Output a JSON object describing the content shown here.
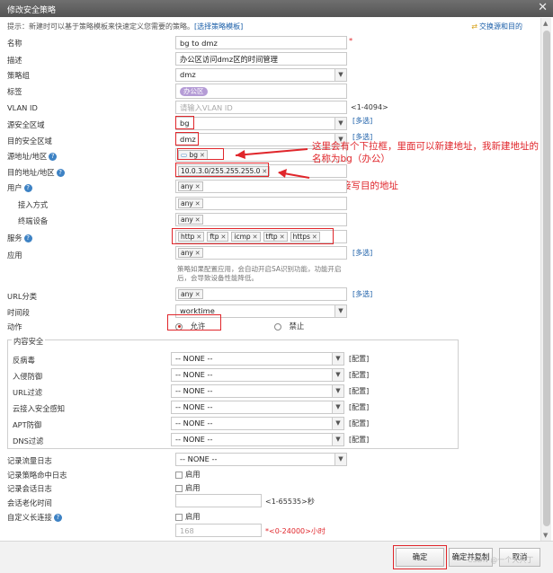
{
  "dialog": {
    "title": "修改安全策略",
    "close": "✕"
  },
  "hint": {
    "text": "提示：新建时可以基于策略模板来快速定义您需要的策略。",
    "link": "[选择策略模板]"
  },
  "swap": {
    "icon": "swap-icon",
    "label": "交换源和目的"
  },
  "fields": {
    "name": {
      "label": "名称",
      "value": "bg to dmz",
      "required": "*"
    },
    "desc": {
      "label": "描述",
      "value": "办公区访问dmz区的时间管理"
    },
    "group": {
      "label": "策略组",
      "value": "dmz"
    },
    "tag": {
      "label": "标签",
      "value": "办公区"
    },
    "vlan": {
      "label": "VLAN ID",
      "placeholder": "请输入VLAN ID",
      "range": "<1-4094>"
    },
    "src_zone": {
      "label": "源安全区域",
      "value": "bg",
      "multi": "[多选]"
    },
    "dst_zone": {
      "label": "目的安全区域",
      "value": "dmz",
      "multi": "[多选]"
    },
    "src_addr": {
      "label": "源地址/地区",
      "value": "bg"
    },
    "dst_addr": {
      "label": "目的地址/地区",
      "value": "10.0.3.0/255.255.255.0"
    },
    "user": {
      "label": "用户",
      "value": "any"
    },
    "access": {
      "label": "接入方式",
      "value": "any"
    },
    "terminal": {
      "label": "终端设备",
      "value": "any"
    },
    "service": {
      "label": "服务",
      "tags": [
        "http",
        "ftp",
        "icmp",
        "tftp",
        "https"
      ]
    },
    "app": {
      "label": "应用",
      "value": "any",
      "multi": "[多选]",
      "note1": "策略如果配置应用，会自动开启SA识别功能，功能开启",
      "note2": "后，会导致设备性能降低。"
    },
    "url": {
      "label": "URL分类",
      "value": "any",
      "multi": "[多选]"
    },
    "time": {
      "label": "时间段",
      "value": "worktime"
    },
    "action": {
      "label": "动作",
      "allow": "允许",
      "deny": "禁止"
    }
  },
  "content_security": {
    "legend": "内容安全",
    "rows": [
      {
        "label": "反病毒",
        "value": "-- NONE --",
        "config": "[配置]"
      },
      {
        "label": "入侵防御",
        "value": "-- NONE --",
        "config": "[配置]"
      },
      {
        "label": "URL过滤",
        "value": "-- NONE --",
        "config": "[配置]"
      },
      {
        "label": "云接入安全感知",
        "value": "-- NONE --",
        "config": "[配置]"
      },
      {
        "label": "APT防御",
        "value": "-- NONE --",
        "config": "[配置]"
      },
      {
        "label": "DNS过滤",
        "value": "-- NONE --",
        "config": "[配置]"
      }
    ]
  },
  "logging": {
    "traffic": {
      "label": "记录流量日志",
      "value": "-- NONE --"
    },
    "hit": {
      "label": "记录策略命中日志",
      "check": "启用"
    },
    "session": {
      "label": "记录会话日志",
      "check": "启用"
    },
    "aging": {
      "label": "会话老化时间",
      "range": "<1-65535>秒"
    },
    "long": {
      "label": "自定义长连接",
      "check": "启用",
      "value": "168",
      "range": "*<0-24000>小时"
    }
  },
  "annotations": {
    "a1_line1": "这里会有个下拉框，里面可以新建地址，我新建地址的",
    "a1_line2": "名称为bg（办公）",
    "a2": "也可以直接写目的地址"
  },
  "buttons": {
    "ok": "确定",
    "ok_copy": "确定并复制",
    "cancel": "取消"
  },
  "watermark": "CSDN @一个大只丁",
  "colors": {
    "annotation": "#e0262b",
    "link": "#1a5ea8"
  }
}
